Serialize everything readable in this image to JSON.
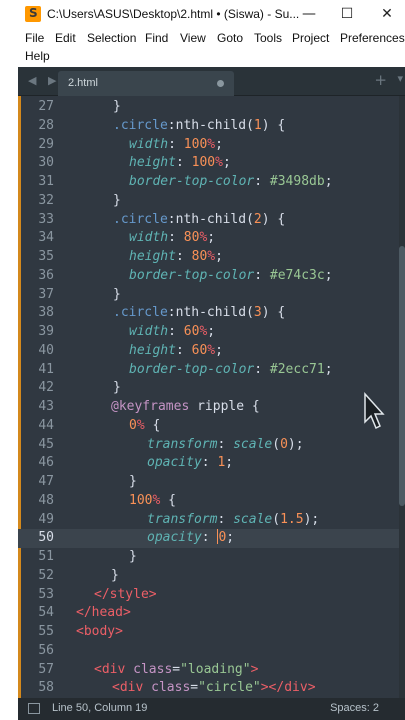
{
  "window": {
    "title": "C:\\Users\\ASUS\\Desktop\\2.html • (Siswa) - Su...",
    "min_glyph": "—",
    "max_glyph": "☐",
    "close_glyph": "✕",
    "app_icon": "sublime-text-icon"
  },
  "menu": {
    "items": [
      "File",
      "Edit",
      "Selection",
      "Find",
      "View",
      "Goto",
      "Tools",
      "Project",
      "Preferences",
      "Help"
    ]
  },
  "tabs": {
    "nav_arrows": "◀ ▶",
    "active_tab": "2.html",
    "plus": "+",
    "chevron": "▾"
  },
  "editor": {
    "current_line": 50,
    "lines": [
      {
        "n": "27"
      },
      {
        "n": "28"
      },
      {
        "n": "29"
      },
      {
        "n": "30"
      },
      {
        "n": "31"
      },
      {
        "n": "32"
      },
      {
        "n": "33"
      },
      {
        "n": "34"
      },
      {
        "n": "35"
      },
      {
        "n": "36"
      },
      {
        "n": "37"
      },
      {
        "n": "38"
      },
      {
        "n": "39"
      },
      {
        "n": "40"
      },
      {
        "n": "41"
      },
      {
        "n": "42"
      },
      {
        "n": "43"
      },
      {
        "n": "44"
      },
      {
        "n": "45"
      },
      {
        "n": "46"
      },
      {
        "n": "47"
      },
      {
        "n": "48"
      },
      {
        "n": "49"
      },
      {
        "n": "50"
      },
      {
        "n": "51"
      },
      {
        "n": "52"
      },
      {
        "n": "53"
      },
      {
        "n": "54"
      },
      {
        "n": "55"
      },
      {
        "n": "56"
      },
      {
        "n": "57"
      },
      {
        "n": "58"
      }
    ],
    "code": {
      "l27": "}",
      "l28_sel": ".circle",
      "l28_pseudo": ":nth-child(",
      "l28_num": "1",
      "l28_end": ") {",
      "l29_prop": "width",
      "l29_colon": ": ",
      "l29_num": "100",
      "l29_unit": "%",
      "l29_semi": ";",
      "l30_prop": "height",
      "l30_colon": ": ",
      "l30_num": "100",
      "l30_unit": "%",
      "l30_semi": ";",
      "l31_prop": "border-top-color",
      "l31_colon": ": ",
      "l31_hex": "#3498db",
      "l31_semi": ";",
      "l32": "}",
      "l33_sel": ".circle",
      "l33_pseudo": ":nth-child(",
      "l33_num": "2",
      "l33_end": ") {",
      "l34_prop": "width",
      "l34_colon": ": ",
      "l34_num": "80",
      "l34_unit": "%",
      "l34_semi": ";",
      "l35_prop": "height",
      "l35_colon": ": ",
      "l35_num": "80",
      "l35_unit": "%",
      "l35_semi": ";",
      "l36_prop": "border-top-color",
      "l36_colon": ": ",
      "l36_hex": "#e74c3c",
      "l36_semi": ";",
      "l37": "}",
      "l38_sel": ".circle",
      "l38_pseudo": ":nth-child(",
      "l38_num": "3",
      "l38_end": ") {",
      "l39_prop": "width",
      "l39_colon": ": ",
      "l39_num": "60",
      "l39_unit": "%",
      "l39_semi": ";",
      "l40_prop": "height",
      "l40_colon": ": ",
      "l40_num": "60",
      "l40_unit": "%",
      "l40_semi": ";",
      "l41_prop": "border-top-color",
      "l41_colon": ": ",
      "l41_hex": "#2ecc71",
      "l41_semi": ";",
      "l42": "}",
      "l43_at": "@keyframes",
      "l43_name": " ripple {",
      "l44_num": "0",
      "l44_unit": "%",
      "l44_end": " {",
      "l45_prop": "transform",
      "l45_colon": ": ",
      "l45_fn": "scale",
      "l45_open": "(",
      "l45_num": "0",
      "l45_close": ");",
      "l46_prop": "opacity",
      "l46_colon": ": ",
      "l46_num": "1",
      "l46_semi": ";",
      "l47": "}",
      "l48_num": "100",
      "l48_unit": "%",
      "l48_end": " {",
      "l49_prop": "transform",
      "l49_colon": ": ",
      "l49_fn": "scale",
      "l49_open": "(",
      "l49_num": "1.5",
      "l49_close": ");",
      "l50_prop": "opacity",
      "l50_colon": ": ",
      "l50_num": "0",
      "l50_semi": ";",
      "l51": "}",
      "l52": "}",
      "l53_open": "</",
      "l53_tag": "style",
      "l53_close": ">",
      "l54_open": "</",
      "l54_tag": "head",
      "l54_close": ">",
      "l55_open": "<",
      "l55_tag": "body",
      "l55_close": ">",
      "l57_open": "<",
      "l57_tag": "div",
      "l57_attr": " class",
      "l57_eq": "=",
      "l57_str": "\"loading\"",
      "l57_close": ">",
      "l58_open": "<",
      "l58_tag": "div",
      "l58_attr": " class",
      "l58_eq": "=",
      "l58_str": "\"circle\"",
      "l58_mid": "></",
      "l58_tag2": "div",
      "l58_close": ">"
    }
  },
  "status": {
    "position": "Line 50, Column 19",
    "spaces": "Spaces: 2"
  },
  "colors": {
    "editor_bg": "#303841",
    "gutter_accent": "#d4891c",
    "selector": "#6699cc",
    "property": "#5fb4b4",
    "number": "#f99157",
    "unit": "#ec5f67",
    "string": "#99c794",
    "at_rule": "#c594c5"
  }
}
